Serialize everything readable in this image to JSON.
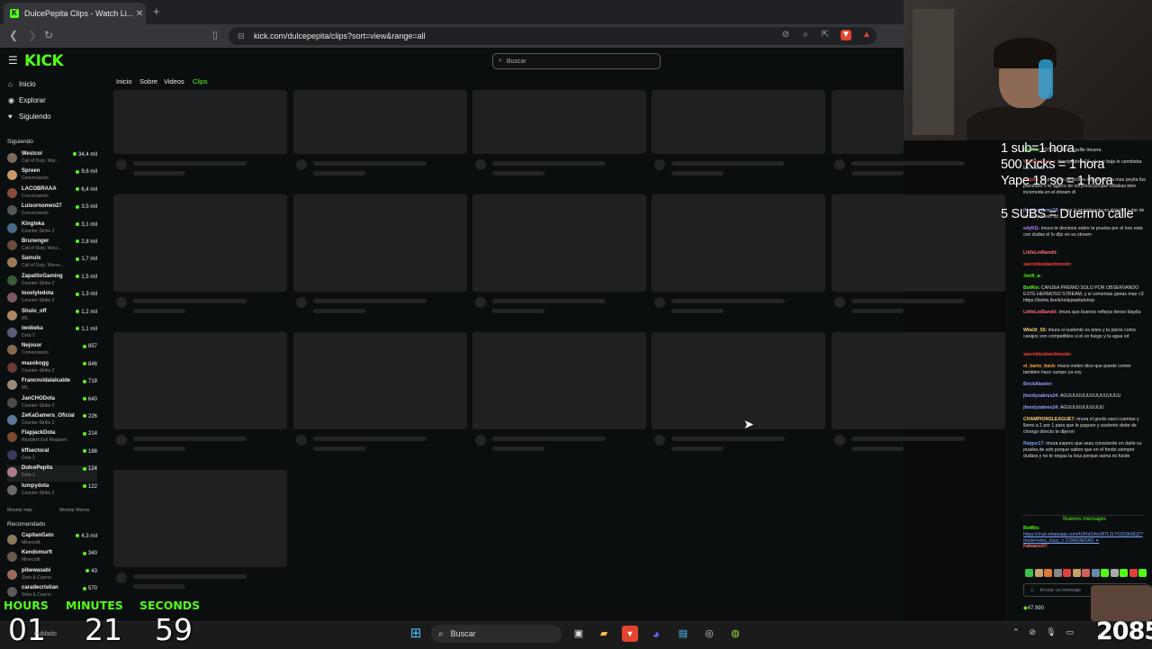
{
  "browser": {
    "tab_title": "DulcePepita Clips - Watch Li...",
    "tab_close": "✕",
    "new_tab": "+",
    "url": "kick.com/dulcepepita/clips?sort=view&range=all"
  },
  "kick": {
    "logo": "KICK",
    "search_placeholder": "Buscar",
    "nav": [
      {
        "label": "Inicio",
        "icon": "⌂"
      },
      {
        "label": "Explorar",
        "icon": "◉"
      },
      {
        "label": "Siguiendo",
        "icon": "♥"
      }
    ],
    "following_header": "Siguiendo",
    "following": [
      {
        "name": "Westcol",
        "game": "Call of Duty: War...",
        "viewers": "34,4 mil",
        "color": "#7a6a5a"
      },
      {
        "name": "Spreen",
        "game": "Conversando",
        "viewers": "9,6 mil",
        "color": "#c99a6b"
      },
      {
        "name": "LACOBRAAA",
        "game": "Conversando",
        "viewers": "6,4 mil",
        "color": "#8a4a3a"
      },
      {
        "name": "Luisornomeo27",
        "game": "Conversando",
        "viewers": "3,5 mil",
        "color": "#555"
      },
      {
        "name": "Kingteka",
        "game": "Counter-Strike 2",
        "viewers": "3,1 mil",
        "color": "#4a6a8a"
      },
      {
        "name": "Brunenger",
        "game": "Call of Duty: Warz...",
        "viewers": "2,8 mil",
        "color": "#6a4a3a"
      },
      {
        "name": "Samulx",
        "game": "Call of Duty: Warzo...",
        "viewers": "1,7 mil",
        "color": "#9a7a5a"
      },
      {
        "name": "ZapatitoGaming",
        "game": "Counter-Strike 2",
        "viewers": "1,5 mil",
        "color": "#3a5a3a"
      },
      {
        "name": "loostyledota",
        "game": "Counter-Strike 2",
        "viewers": "1,3 mil",
        "color": "#7a5a6a"
      },
      {
        "name": "Shulo_off",
        "game": "IRL",
        "viewers": "1,2 mil",
        "color": "#aa8866"
      },
      {
        "name": "iwobeka",
        "game": "Dota 2",
        "viewers": "1,1 mil",
        "color": "#5a5a7a"
      },
      {
        "name": "Nejosor",
        "game": "Conversando",
        "viewers": "857",
        "color": "#8a6a4a"
      },
      {
        "name": "masokogg",
        "game": "Counter-Strike 2",
        "viewers": "846",
        "color": "#6a3a3a"
      },
      {
        "name": "Francovidalalcalde",
        "game": "IRL",
        "viewers": "718",
        "color": "#9a8a7a"
      },
      {
        "name": "JanCHODota",
        "game": "Counter-Strike 2",
        "viewers": "640",
        "color": "#4a4a4a"
      },
      {
        "name": "ZeKaGamers_Oficial",
        "game": "Counter-Strike 2",
        "viewers": "226",
        "color": "#5a7a9a"
      },
      {
        "name": "FlapjackDota",
        "game": "Resident Evil Requiem",
        "viewers": "214",
        "color": "#7a4a2a"
      },
      {
        "name": "kffsectoral",
        "game": "Dota 2",
        "viewers": "188",
        "color": "#3a3a5a"
      },
      {
        "name": "DulcePepita",
        "game": "Dota 2",
        "viewers": "124",
        "color": "#b07a8a"
      },
      {
        "name": "lumpydota",
        "game": "Counter-Strike 2",
        "viewers": "122",
        "color": "#6a6a6a"
      }
    ],
    "show_more": "Mostrar más",
    "show_less": "Mostrar Menos",
    "recommended_header": "Recomendado",
    "recommended": [
      {
        "name": "CapitanGato",
        "game": "Minecraft",
        "viewers": "4,3 mil",
        "color": "#8a7a5a"
      },
      {
        "name": "Kendomurft",
        "game": "Minecraft",
        "viewers": "340",
        "color": "#6a5a4a"
      },
      {
        "name": "pibewasabi",
        "game": "Slots & Casino",
        "viewers": "43",
        "color": "#9a6a5a"
      },
      {
        "name": "caradecristian",
        "game": "Slots & Casino",
        "viewers": "570",
        "color": "#5a5a5a"
      }
    ],
    "channel_tabs": [
      "Inicio",
      "Sobre",
      "Videos",
      "Clips"
    ],
    "active_tab": "Clips"
  },
  "stream_overlay": {
    "lines": [
      "1 sub=1 hora",
      "500 Kicks = 1 hora",
      "Yape 18 so = 1 hora",
      "5 SUBS = Duermo calle"
    ],
    "timer_labels": [
      "HOURS",
      "MINUTES",
      "SECONDS"
    ],
    "timer_values": [
      "01",
      "21",
      "59"
    ],
    "big_number": "2085",
    "watermark": "nublado"
  },
  "chat": {
    "messages": [
      {
        "user": "BotRix:",
        "text": "BDT DE VD2 • ¡gullle tmuera",
        "color": "#53fc18"
      },
      {
        "user": "Wilmonticoles:",
        "text": "jhordyzabres24: el que baja le cambiaba las huvias",
        "color": "#e05555"
      },
      {
        "user": "viejoel:",
        "text": "imura fuera de broma sale pepita la mas peyita fue planeado o te agarro de sorpresa porque estabas bien incomoda en el stream dl",
        "color": "#e05555"
      },
      {
        "user": "jhordyzabres24:",
        "text": "imura la importancia no dotener y dar de lactar a la vez xd",
        "color": "#9aa0ff"
      },
      {
        "user": "edyKG:",
        "text": "imura te decimos sobre la prueba por el loro esta con dudas el lo dijo en su stream",
        "color": "#c080ff"
      },
      {
        "user": "LittleLioBandit:",
        "text": "",
        "color": "#ff7070"
      },
      {
        "user": "sacrebleubandonedo:",
        "text": "",
        "color": "#ff4040"
      },
      {
        "user": "Jorill_a:",
        "text": "",
        "color": "#53fc18"
      },
      {
        "user": "BotRix:",
        "text": "CANJEA PREMIO SOLO POR OBSERVANDO ESTE HERMOSO STREAM, y si comentas ganas mas <3 https://botrix.live/k/onlypepita/shop",
        "color": "#53fc18"
      },
      {
        "user": "LittleLioBandit:",
        "text": "imura que buenos reflejos tienes klaylla",
        "color": "#ff7070"
      },
      {
        "user": "Wlat3r_55:",
        "text": "imura si sustento es aries y tu piscis como carajos son compatibles si el es fuego y tu agua xd",
        "color": "#ffd070"
      },
      {
        "user": "sacrebleubandonedo:",
        "text": "",
        "color": "#ff4040"
      },
      {
        "user": "el_barto_back:",
        "text": "imura meteo dice que puede comer tambien hace campo ya voy",
        "color": "#ffa040"
      },
      {
        "user": "BrickAlastor:",
        "text": "",
        "color": "#9aa0ff"
      },
      {
        "user": "jhordyzabres24:",
        "text": "AGUUUUUUUUUUUUUUUU",
        "color": "#9aa0ff"
      },
      {
        "user": "jhordyzabres24:",
        "text": "AGUUUUUUUUUUU",
        "color": "#9aa0ff"
      },
      {
        "user": "CHAMPIONSLEAGUE7:",
        "text": "imura el gordo saco cuentas y llamo a 1 por 1 para que le paguen y sustento debe de chongo directo te dijeron",
        "color": "#ffd070"
      },
      {
        "user": "Raigor17:",
        "text": "imura espero que seas consciente en darle su prueba de adn porque sabes que en el fondo siempre dudara y no te negas la loca porque sarna no fuiste",
        "color": "#70a0ff"
      }
    ],
    "new_messages": "Nuevos mensajes",
    "last_messages": [
      {
        "user": "BotRix:",
        "text": "https://chat.whatsapp.com/H2Kd14nU87L2LYOZQkSlQ2?mode=ems_copy_c COMUNIDAD ✦",
        "color": "#53fc18"
      },
      {
        "user": "Fabiano37:",
        "text": "",
        "color": "#ff7070"
      }
    ],
    "input_placeholder": "Enviar un mensaje",
    "bottom_count": "47.990"
  },
  "taskbar": {
    "search_label": "Buscar"
  }
}
